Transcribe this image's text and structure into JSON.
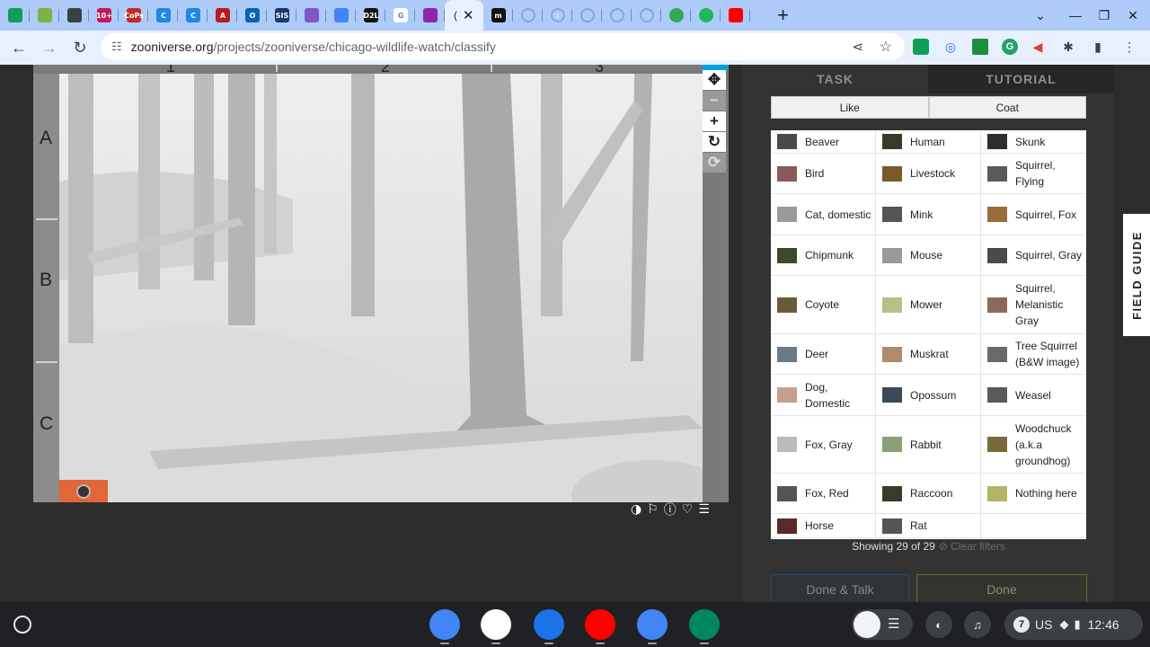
{
  "browser": {
    "tabs": [
      {
        "icon": "sheets-icon",
        "color": "#0f9d58",
        "glyph": ""
      },
      {
        "icon": "grid-app-icon",
        "color": "#7cb342",
        "glyph": ""
      },
      {
        "icon": "calendar-grid-icon",
        "color": "#3c4043",
        "glyph": ""
      },
      {
        "icon": "ten-plus-icon",
        "color": "#c2185b",
        "glyph": "10+"
      },
      {
        "icon": "cops-icon",
        "color": "#c62828",
        "glyph": "CoPs"
      },
      {
        "icon": "canva-icon",
        "color": "#1e88e5",
        "glyph": "C"
      },
      {
        "icon": "canva-icon",
        "color": "#1e88e5",
        "glyph": "C"
      },
      {
        "icon": "a-letter-icon",
        "color": "#b71c1c",
        "glyph": "A"
      },
      {
        "icon": "outlook-icon",
        "color": "#0a64ad",
        "glyph": "O"
      },
      {
        "icon": "sis-icon",
        "color": "#1a3a6b",
        "glyph": "SIS"
      },
      {
        "icon": "classroom-icon",
        "color": "#7e57c2",
        "glyph": ""
      },
      {
        "icon": "docs-icon",
        "color": "#4285f4",
        "glyph": ""
      },
      {
        "icon": "d2l-icon",
        "color": "#111111",
        "glyph": "D2L"
      },
      {
        "icon": "google-icon",
        "color": "#ffffff",
        "glyph": "G"
      },
      {
        "icon": "paw-icon",
        "color": "#8e24aa",
        "glyph": ""
      }
    ],
    "active_tab_title": "(",
    "tabs_after": [
      {
        "icon": "m-letter-icon",
        "color": "#111111",
        "glyph": "m"
      },
      {
        "icon": "loading-icon",
        "color": "#aecbfa",
        "glyph": ""
      },
      {
        "icon": "loading-icon",
        "color": "#aecbfa",
        "glyph": ":"
      },
      {
        "icon": "loading-icon",
        "color": "#aecbfa",
        "glyph": ""
      },
      {
        "icon": "loading-icon",
        "color": "#aecbfa",
        "glyph": ""
      },
      {
        "icon": "loading-icon",
        "color": "#aecbfa",
        "glyph": ""
      },
      {
        "icon": "cloud-up-icon",
        "color": "#34a853",
        "glyph": ""
      },
      {
        "icon": "spotify-icon",
        "color": "#1db954",
        "glyph": ""
      },
      {
        "icon": "youtube-icon",
        "color": "#ff0000",
        "glyph": ""
      }
    ],
    "url_domain": "zooniverse.org",
    "url_path": "/projects/zooniverse/chicago-wildlife-watch/classify"
  },
  "viewer": {
    "row_labels": [
      "A",
      "B",
      "C"
    ],
    "col_labels": [
      "1",
      "2",
      "3"
    ]
  },
  "task_tabs": {
    "task": "TASK",
    "tutorial": "TUTORIAL"
  },
  "filters": {
    "like": "Like",
    "coat": "Coat"
  },
  "species": [
    [
      {
        "name": "Beaver",
        "color": "#4a4a4a"
      },
      {
        "name": "Human",
        "color": "#3b3a2a"
      },
      {
        "name": "Skunk",
        "color": "#2e2e2e"
      }
    ],
    [
      {
        "name": "Bird",
        "color": "#8a5a5a"
      },
      {
        "name": "Livestock",
        "color": "#7a5a2a"
      },
      {
        "name": "Squirrel, Flying",
        "color": "#5a5a5a"
      }
    ],
    [
      {
        "name": "Cat, domestic",
        "color": "#9a9a9a"
      },
      {
        "name": "Mink",
        "color": "#555555"
      },
      {
        "name": "Squirrel, Fox",
        "color": "#9a6a3a"
      }
    ],
    [
      {
        "name": "Chipmunk",
        "color": "#3a4a2a"
      },
      {
        "name": "Mouse",
        "color": "#999999"
      },
      {
        "name": "Squirrel, Gray",
        "color": "#4a4a4a"
      }
    ],
    [
      {
        "name": "Coyote",
        "color": "#6a5a3a"
      },
      {
        "name": "Mower",
        "color": "#b5c08a"
      },
      {
        "name": "Squirrel, Melanistic Gray",
        "color": "#8a6a5a"
      }
    ],
    [
      {
        "name": "Deer",
        "color": "#6a7a8a"
      },
      {
        "name": "Muskrat",
        "color": "#b08a6a"
      },
      {
        "name": "Tree Squirrel (B&W image)",
        "color": "#6a6a6a"
      }
    ],
    [
      {
        "name": "Dog, Domestic",
        "color": "#c4a08a"
      },
      {
        "name": "Opossum",
        "color": "#3a4a5a"
      },
      {
        "name": "Weasel",
        "color": "#5a5a5a"
      }
    ],
    [
      {
        "name": "Fox, Gray",
        "color": "#bbbbbb"
      },
      {
        "name": "Rabbit",
        "color": "#8aa07a"
      },
      {
        "name": "Woodchuck (a.k.a groundhog)",
        "color": "#7a6a3a"
      }
    ],
    [
      {
        "name": "Fox, Red",
        "color": "#555555"
      },
      {
        "name": "Raccoon",
        "color": "#3a3a2a"
      },
      {
        "name": "Nothing here",
        "color": "#b0b56a"
      }
    ],
    [
      {
        "name": "Horse",
        "color": "#5a2a2a"
      },
      {
        "name": "Rat",
        "color": "#555555"
      },
      {
        "name": "",
        "color": ""
      }
    ]
  ],
  "showing_text": "Showing 29 of 29",
  "clear_filters": "⊘ Clear filters",
  "buttons": {
    "done_talk": "Done & Talk",
    "done": "Done"
  },
  "field_guide": "FIELD GUIDE",
  "shelf": {
    "apps": [
      {
        "name": "chrome-app",
        "color": "#4285f4"
      },
      {
        "name": "gmail-app",
        "color": "#ffffff"
      },
      {
        "name": "files-app",
        "color": "#1a73e8"
      },
      {
        "name": "youtube-app",
        "color": "#ff0000"
      },
      {
        "name": "docs-app",
        "color": "#4285f4"
      },
      {
        "name": "play-store-app",
        "color": "#01875f"
      }
    ],
    "notification_count": "7",
    "keyboard_layout": "US",
    "time": "12:46"
  }
}
